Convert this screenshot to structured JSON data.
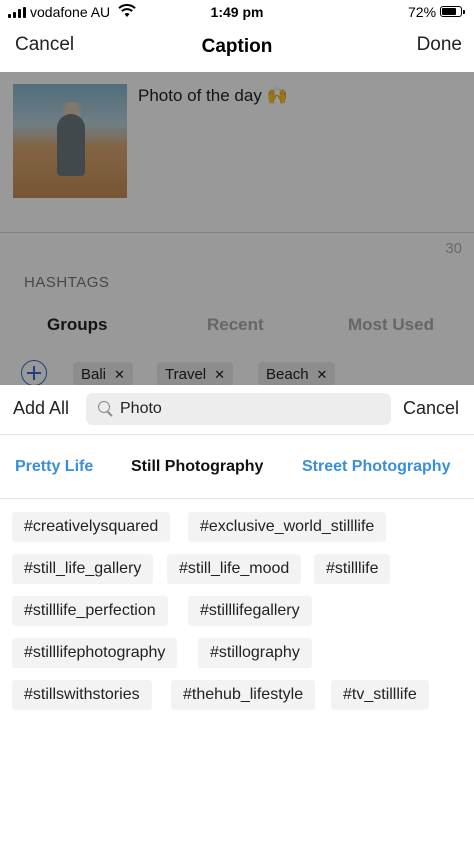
{
  "status_bar": {
    "carrier": "vodafone AU",
    "time": "1:49 pm",
    "battery": "72%"
  },
  "nav": {
    "cancel": "Cancel",
    "title": "Caption",
    "done": "Done"
  },
  "caption": {
    "text": "Photo of the day 🙌",
    "char_count": "30"
  },
  "hashtags": {
    "label": "HASHTAGS",
    "tabs": [
      "Groups",
      "Recent",
      "Most Used"
    ],
    "chips": [
      "Bali",
      "Travel",
      "Beach"
    ]
  },
  "search": {
    "add_all": "Add All",
    "query": "Photo",
    "cancel": "Cancel"
  },
  "subtabs": [
    "Pretty Life",
    "Still Photography",
    "Street Photography"
  ],
  "tags": [
    "#creativelysquared",
    "#exclusive_world_stilllife",
    "#still_life_gallery",
    "#still_life_mood",
    "#stilllife",
    "#stilllife_perfection",
    "#stilllifegallery",
    "#stilllifephotography",
    "#stillography",
    "#stillswithstories",
    "#thehub_lifestyle",
    "#tv_stilllife"
  ],
  "colors": {
    "accent_blue": "#3b8fd6",
    "chip_bg": "#f3f3f3"
  }
}
